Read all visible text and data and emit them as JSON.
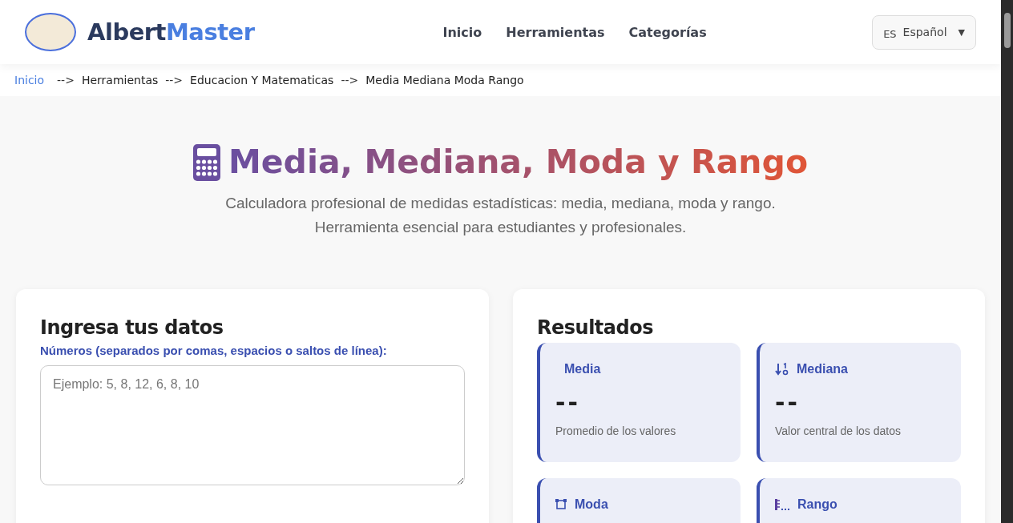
{
  "header": {
    "brand": {
      "first": "Albert",
      "second": "Master"
    },
    "nav": [
      "Inicio",
      "Herramientas",
      "Categorías"
    ],
    "language": {
      "code": "ES",
      "label": "Español",
      "caret": "▼"
    }
  },
  "breadcrumb": {
    "items": [
      {
        "label": "Inicio",
        "link": true
      },
      {
        "label": "Herramientas",
        "link": false
      },
      {
        "label": "Educacion Y Matematicas",
        "link": false
      },
      {
        "label": "Media Mediana Moda Rango",
        "link": false
      }
    ],
    "separator": "-->"
  },
  "hero": {
    "title": "Media, Mediana, Moda y Rango",
    "subtitle": [
      "Calculadora profesional de medidas estadísticas: media, mediana, moda y rango.",
      "Herramienta esencial para estudiantes y profesionales."
    ]
  },
  "input_card": {
    "title": "Ingresa tus datos",
    "label": "Números (separados por comas, espacios o saltos de línea):",
    "placeholder": "Ejemplo: 5, 8, 12, 6, 8, 10"
  },
  "results": {
    "title": "Resultados",
    "stats": [
      {
        "kind": "mean",
        "label": "Media",
        "value": "--",
        "description": "Promedio de los valores"
      },
      {
        "kind": "median",
        "label": "Mediana",
        "value": "--",
        "description": "Valor central de los datos"
      },
      {
        "kind": "mode",
        "label": "Moda"
      },
      {
        "kind": "range",
        "label": "Rango"
      }
    ]
  }
}
